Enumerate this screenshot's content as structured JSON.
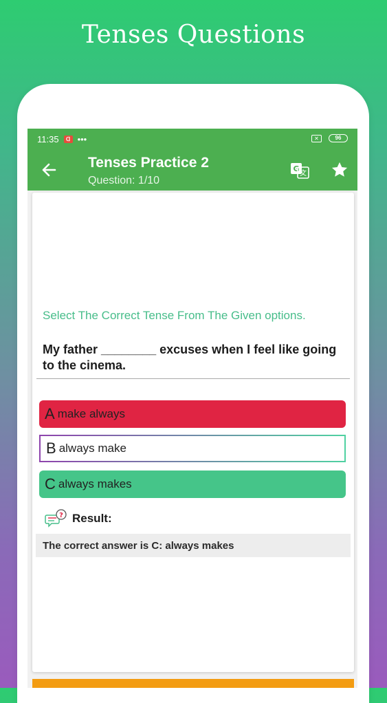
{
  "promo": {
    "title": "Tenses Questions"
  },
  "status_bar": {
    "time": "11:35",
    "notification": "••• ",
    "battery": "96"
  },
  "app_bar": {
    "title": "Tenses Practice 2",
    "subtitle": "Question: 1/10"
  },
  "quiz": {
    "instruction": "Select The Correct Tense From The Given options.",
    "question": "My father ________ excuses when I feel like going to the cinema.",
    "options": [
      {
        "letter": "A",
        "text": "make always",
        "state": "wrong",
        "color": "#e02443"
      },
      {
        "letter": "B",
        "text": "always make",
        "state": "neutral",
        "color": "#ffffff"
      },
      {
        "letter": "C",
        "text": "always makes",
        "state": "correct",
        "color": "#45c589"
      }
    ],
    "result_label": "Result:",
    "result_text": "The correct answer is C: always makes"
  },
  "icons": {
    "back": "arrow-left-icon",
    "translate": "translate-icon",
    "favorite": "star-icon",
    "result": "chat-question-icon",
    "fab": "list-icon"
  },
  "colors": {
    "appbar": "#4caf50",
    "instruction": "#47bd8a",
    "accent_bar": "#f39c12"
  }
}
